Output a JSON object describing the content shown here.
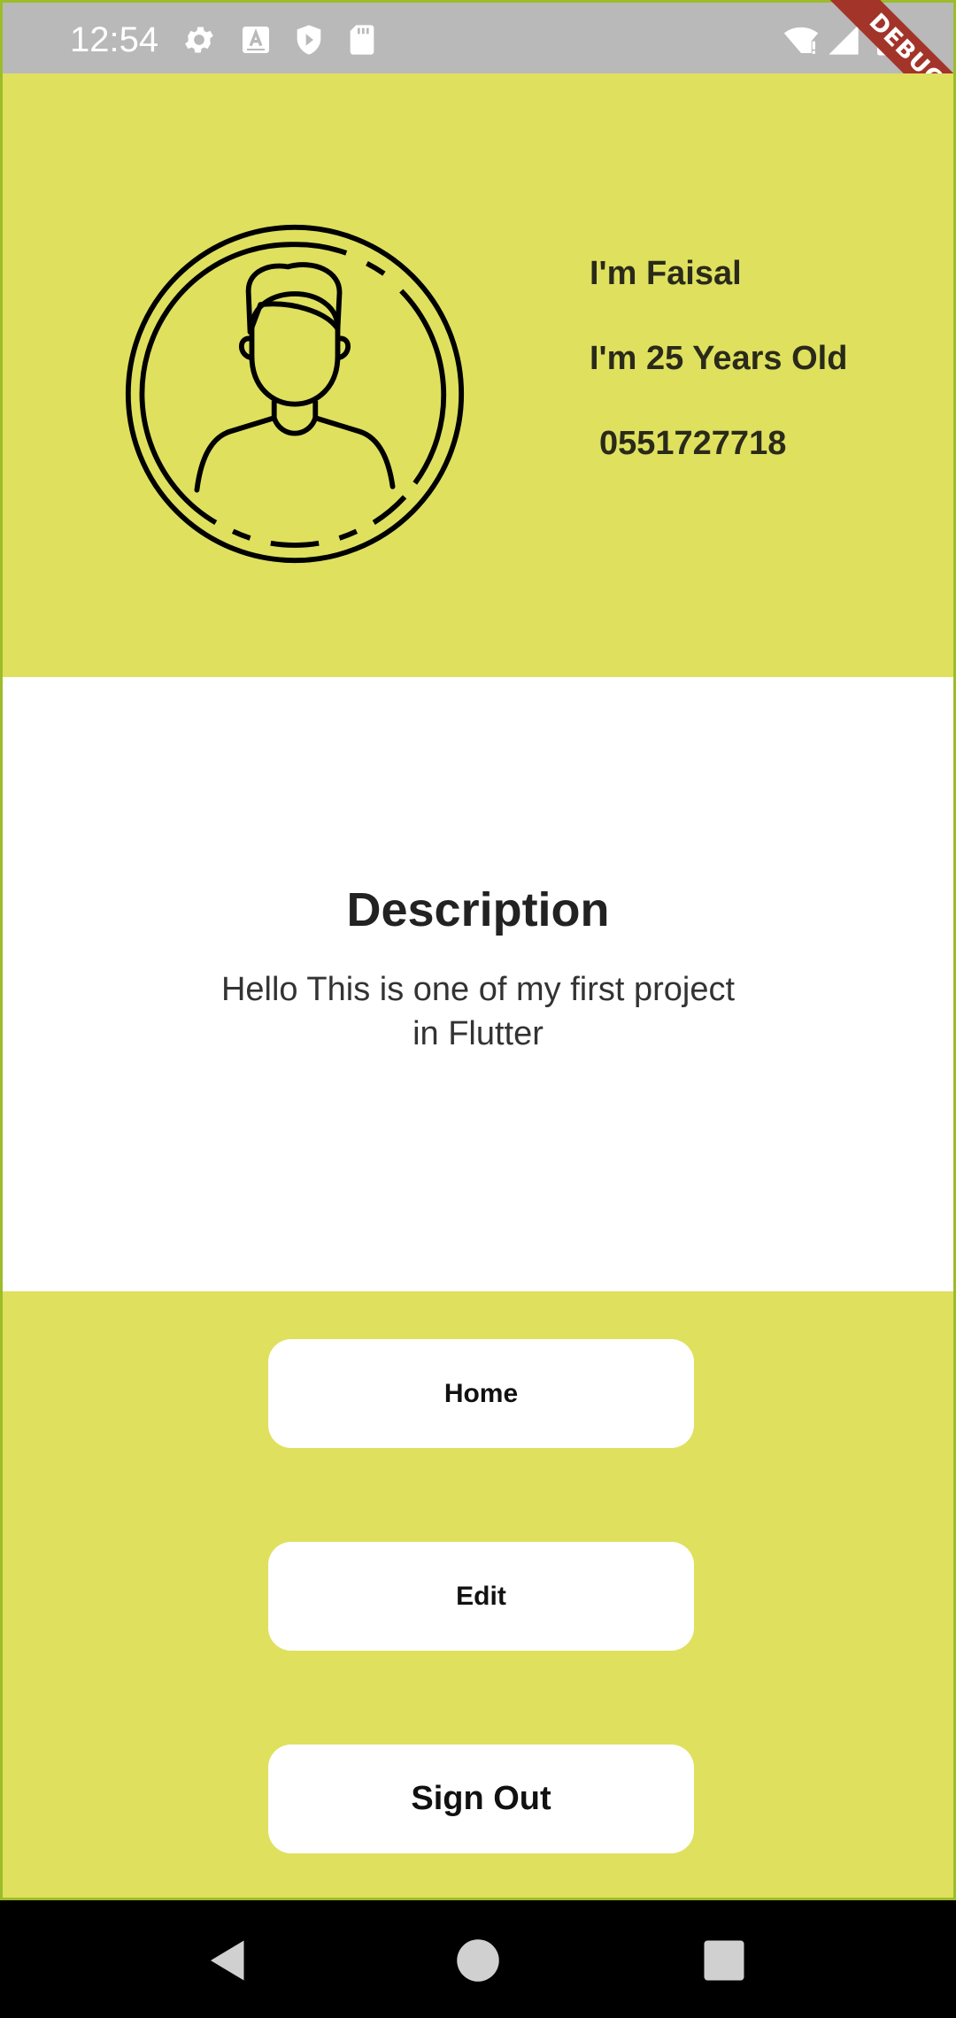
{
  "status_bar": {
    "time": "12:54",
    "left_icons": [
      "gear-icon",
      "a-box-icon",
      "shield-play-icon",
      "sd-card-icon"
    ],
    "right_icons": [
      "wifi-alert-icon",
      "cell-signal-icon",
      "battery-icon"
    ]
  },
  "debug_banner": {
    "label": "DEBUG"
  },
  "profile": {
    "avatar_icon": "person-avatar-icon",
    "name_line": "I'm Faisal",
    "age_line": "I'm 25 Years Old",
    "phone_line": "0551727718"
  },
  "description": {
    "title": "Description",
    "body": "Hello This is one of my first project in Flutter"
  },
  "buttons": {
    "home_label": "Home",
    "edit_label": "Edit",
    "signout_label": "Sign Out"
  },
  "nav_bar": {
    "icons": [
      "back-triangle-icon",
      "home-circle-icon",
      "recents-square-icon"
    ]
  },
  "colors": {
    "accent_yellow": "#dfe05e",
    "status_bar_gray": "#b9b9b9",
    "debug_red": "#a3342a",
    "border_green": "#9cbc2a"
  }
}
